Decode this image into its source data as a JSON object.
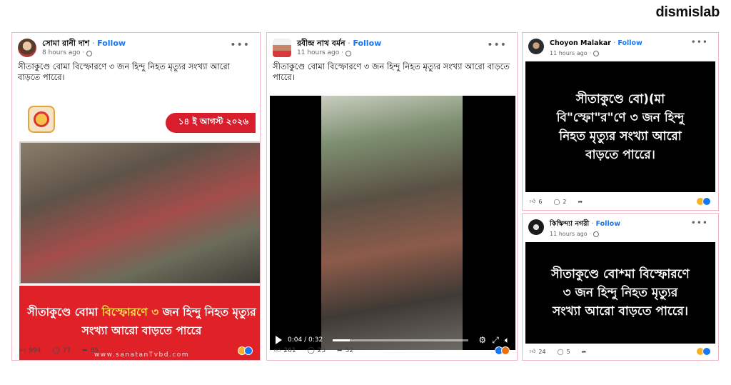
{
  "brand": "dismislab",
  "posts": [
    {
      "author": "সোমা রানী দাশ",
      "follow": "Follow",
      "time": "8 hours ago",
      "caption": "সীতাকুণ্ডে বোমা  বিস্ফোরণে ৩ জন হিন্দু নিহত মৃত্যুর সংখ্যা আরো বাড়তে পারেে।",
      "graphic": {
        "date": "১৪ ই আগস্ট ২০২৬",
        "headline_part1": "সীতাকুণ্ডে বোমা  ",
        "headline_highlight": "বিস্ফোরণে ৩",
        "headline_part2": " জন হিন্দু নিহত মৃত্যুর সংখ্যা আরো বাড়তে পারেে",
        "site": "www.sanatanTvbd.com"
      },
      "likes": "994",
      "comments": "77",
      "shares": "85"
    },
    {
      "author": "রবীন্দ্র নাথ বর্মন",
      "follow": "Follow",
      "time": "11 hours ago",
      "caption": "সীতাকুণ্ডে বোমা  বিস্ফোরণে ৩ জন হিন্দু নিহত মৃত্যুর সংখ্যা আরো বাড়তে পারেে।",
      "video_time": "0:04 / 0:32",
      "video_progress": 0.125,
      "likes": "261",
      "comments": "23",
      "shares": "52"
    },
    {
      "author": "Choyon Malakar",
      "follow": "Follow",
      "time": "11 hours ago",
      "text": "সীতাকুণ্ডে বো)(মা\nবি\"স্ফো\"র\"ণে ৩ জন হিন্দু\nনিহত মৃত্যুর সংখ্যা আরো\nবাড়তে পারেে।",
      "likes": "6",
      "comments": "2"
    },
    {
      "author": "কিস্কিন্দ্যা নগরী",
      "follow": "Follow",
      "time": "11 hours ago",
      "text": "সীতাকুণ্ডে বো*মা বিস্ফোরণে\n৩ জন হিন্দু নিহত মৃত্যুর\nসংখ্যা আরো বাড়তে পারেে।",
      "likes": "24",
      "comments": "5"
    }
  ],
  "colors": {
    "card_border": "#f0b8c4",
    "follow_blue": "#1877f2",
    "banner_red": "#e02128",
    "highlight_yellow": "#ffe24a"
  }
}
